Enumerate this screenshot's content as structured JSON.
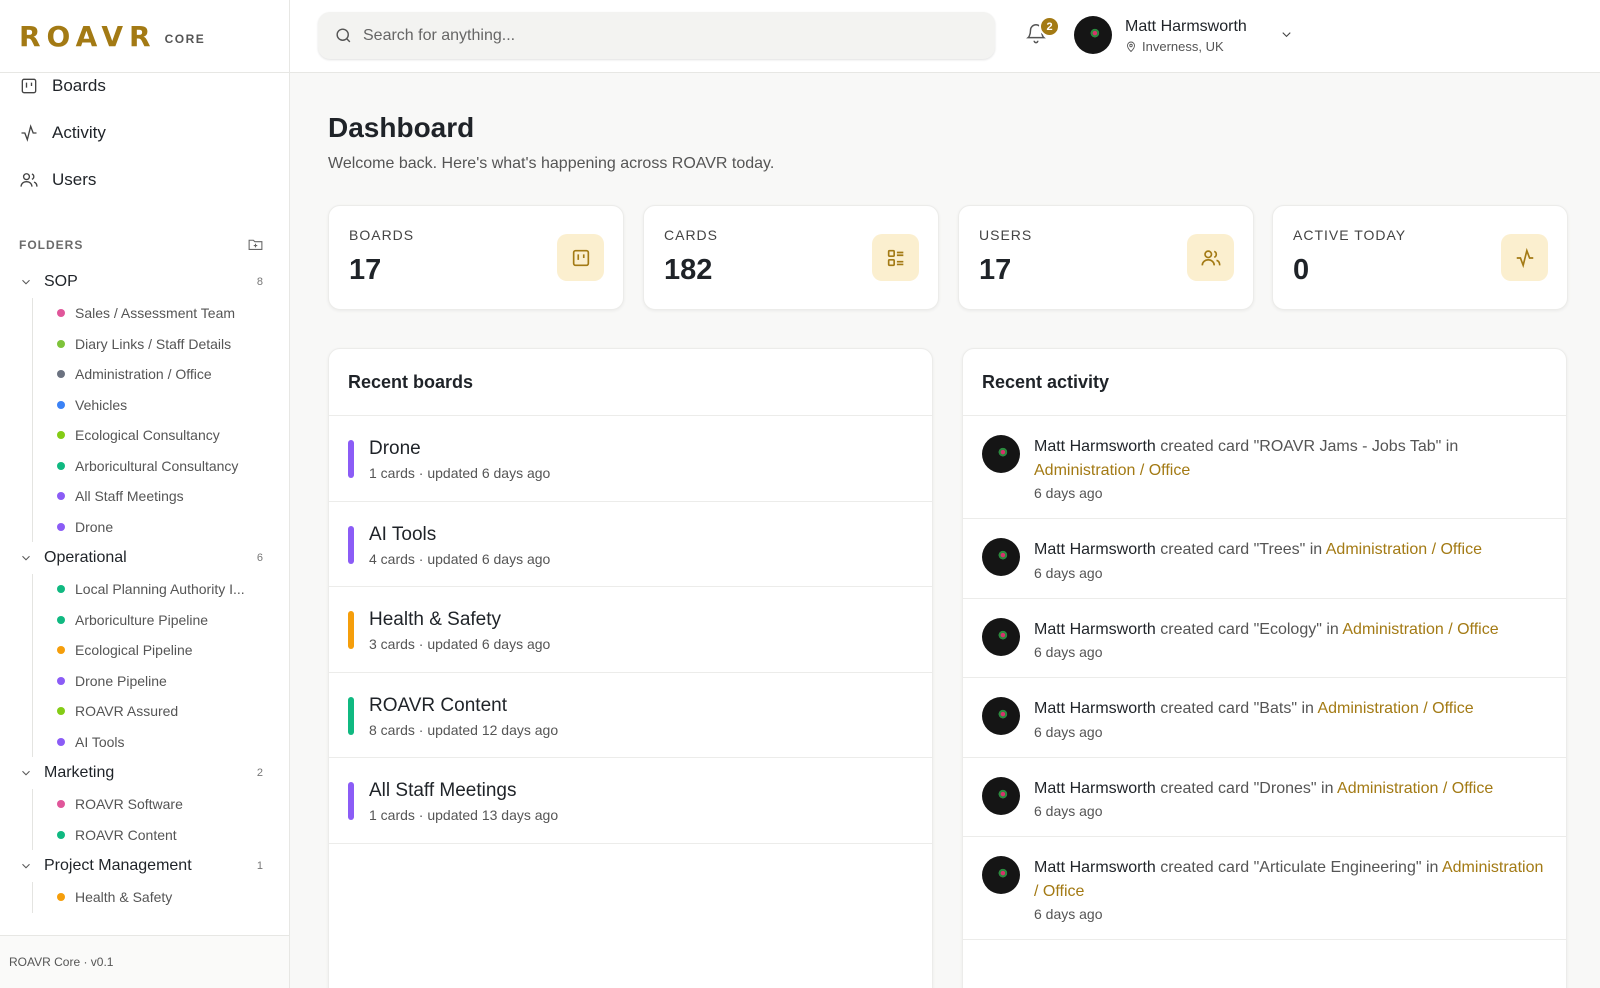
{
  "brand": {
    "logo": "ROAVR",
    "subtitle": "CORE"
  },
  "nav": [
    {
      "label": "Boards",
      "icon": "board-icon"
    },
    {
      "label": "Activity",
      "icon": "activity-icon"
    },
    {
      "label": "Users",
      "icon": "users-icon"
    }
  ],
  "folders": {
    "heading": "FOLDERS",
    "groups": [
      {
        "name": "SOP",
        "count": "8",
        "items": [
          {
            "label": "Sales / Assessment Team",
            "color": "#e0569a"
          },
          {
            "label": "Diary Links / Staff Details",
            "color": "#7ec33a"
          },
          {
            "label": "Administration / Office",
            "color": "#6b7280"
          },
          {
            "label": "Vehicles",
            "color": "#3b82f6"
          },
          {
            "label": "Ecological Consultancy",
            "color": "#84cc16"
          },
          {
            "label": "Arboricultural Consultancy",
            "color": "#10b981"
          },
          {
            "label": "All Staff Meetings",
            "color": "#8b5cf6"
          },
          {
            "label": "Drone",
            "color": "#8b5cf6"
          }
        ]
      },
      {
        "name": "Operational",
        "count": "6",
        "items": [
          {
            "label": "Local Planning Authority I...",
            "color": "#10b981"
          },
          {
            "label": "Arboriculture Pipeline",
            "color": "#10b981"
          },
          {
            "label": "Ecological Pipeline",
            "color": "#f59e0b"
          },
          {
            "label": "Drone Pipeline",
            "color": "#8b5cf6"
          },
          {
            "label": "ROAVR Assured",
            "color": "#84cc16"
          },
          {
            "label": "AI Tools",
            "color": "#8b5cf6"
          }
        ]
      },
      {
        "name": "Marketing",
        "count": "2",
        "items": [
          {
            "label": "ROAVR Software",
            "color": "#e0569a"
          },
          {
            "label": "ROAVR Content",
            "color": "#10b981"
          }
        ]
      },
      {
        "name": "Project Management",
        "count": "1",
        "items": [
          {
            "label": "Health & Safety",
            "color": "#f59e0b"
          }
        ]
      }
    ]
  },
  "footer": "ROAVR Core · v0.1",
  "search": {
    "placeholder": "Search for anything..."
  },
  "notifications": {
    "count": "2"
  },
  "user": {
    "name": "Matt Harmsworth",
    "location": "Inverness, UK"
  },
  "page": {
    "title": "Dashboard",
    "subtitle": "Welcome back. Here's what's happening across ROAVR today."
  },
  "stats": [
    {
      "label": "BOARDS",
      "value": "17",
      "icon": "board-icon"
    },
    {
      "label": "CARDS",
      "value": "182",
      "icon": "list-icon"
    },
    {
      "label": "USERS",
      "value": "17",
      "icon": "users-icon"
    },
    {
      "label": "ACTIVE TODAY",
      "value": "0",
      "icon": "activity-icon"
    }
  ],
  "recent_boards": {
    "title": "Recent boards",
    "items": [
      {
        "name": "Drone",
        "meta": "1 cards · updated 6 days ago",
        "color": "#8b5cf6"
      },
      {
        "name": "AI Tools",
        "meta": "4 cards · updated 6 days ago",
        "color": "#8b5cf6"
      },
      {
        "name": "Health & Safety",
        "meta": "3 cards · updated 6 days ago",
        "color": "#f59e0b"
      },
      {
        "name": "ROAVR Content",
        "meta": "8 cards · updated 12 days ago",
        "color": "#10b981"
      },
      {
        "name": "All Staff Meetings",
        "meta": "1 cards · updated 13 days ago",
        "color": "#8b5cf6"
      }
    ]
  },
  "recent_activity": {
    "title": "Recent activity",
    "items": [
      {
        "who": "Matt Harmsworth",
        "action": " created card \"ROAVR Jams - Jobs Tab\" in ",
        "where": "Administration / Office",
        "time": "6 days ago"
      },
      {
        "who": "Matt Harmsworth",
        "action": " created card \"Trees\" in ",
        "where": "Administration / Office",
        "time": "6 days ago"
      },
      {
        "who": "Matt Harmsworth",
        "action": " created card \"Ecology\" in ",
        "where": "Administration / Office",
        "time": "6 days ago"
      },
      {
        "who": "Matt Harmsworth",
        "action": " created card \"Bats\" in ",
        "where": "Administration / Office",
        "time": "6 days ago"
      },
      {
        "who": "Matt Harmsworth",
        "action": " created card \"Drones\" in ",
        "where": "Administration / Office",
        "time": "6 days ago"
      },
      {
        "who": "Matt Harmsworth",
        "action": " created card \"Articulate Engineering\" in ",
        "where": "Administration / Office",
        "time": "6 days ago"
      }
    ]
  }
}
